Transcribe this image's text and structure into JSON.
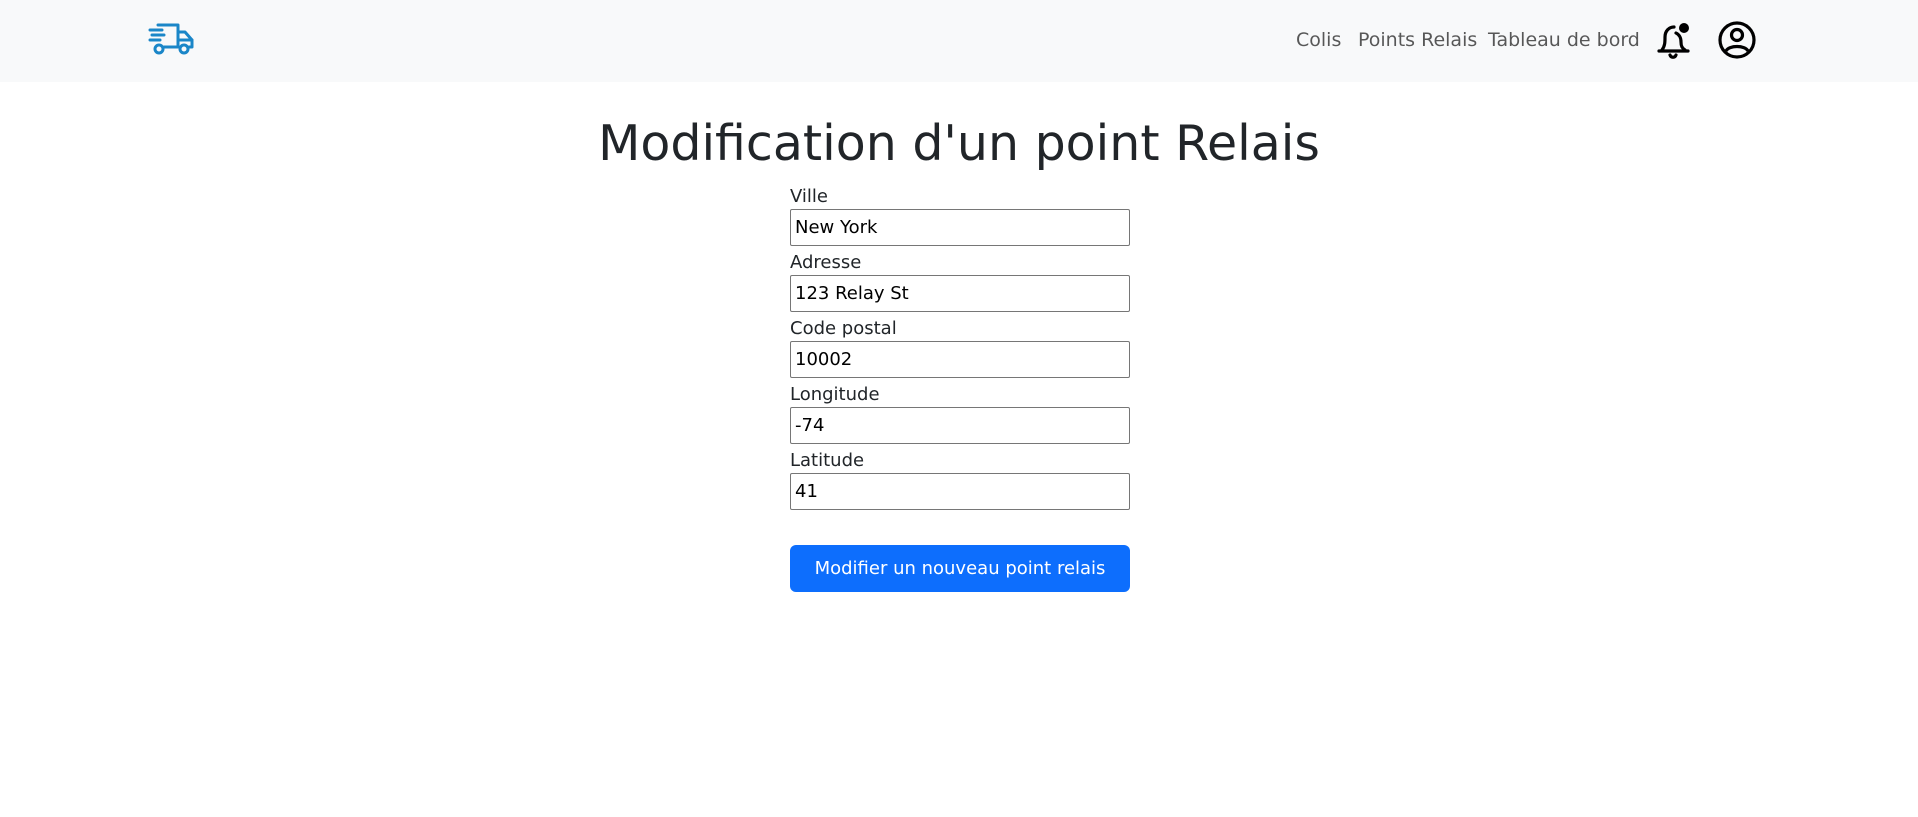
{
  "navbar": {
    "logo_icon": "delivery-truck-icon",
    "links": [
      {
        "label": "Colis"
      },
      {
        "label": "Points Relais"
      },
      {
        "label": "Tableau de bord"
      }
    ],
    "notification_icon": "bell-notification-icon",
    "account_icon": "user-circle-icon"
  },
  "page": {
    "title": "Modification d'un point Relais"
  },
  "form": {
    "fields": [
      {
        "label": "Ville",
        "value": "New York"
      },
      {
        "label": "Adresse",
        "value": "123 Relay St"
      },
      {
        "label": "Code postal",
        "value": "10002"
      },
      {
        "label": "Longitude",
        "value": "-74"
      },
      {
        "label": "Latitude",
        "value": "41"
      }
    ],
    "submit_label": "Modifier un nouveau point relais"
  },
  "colors": {
    "navbar_bg": "#f8f9fa",
    "logo": "#1a86c8",
    "primary": "#0d6efd"
  }
}
